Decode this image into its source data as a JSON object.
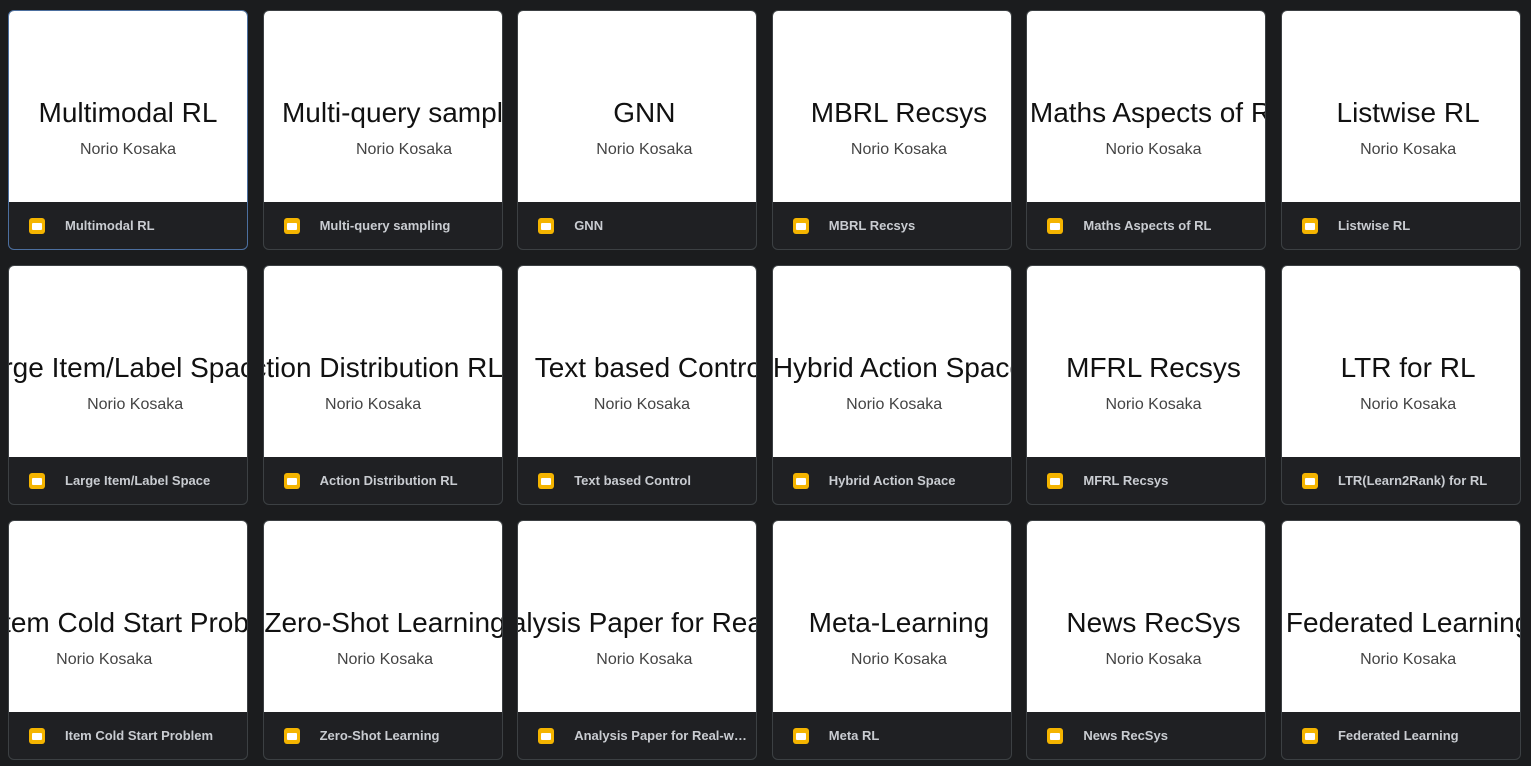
{
  "files": [
    {
      "thumb_title": "Multimodal RL",
      "thumb_author": "Norio Kosaka",
      "name": "Multimodal RL"
    },
    {
      "thumb_title": "Multi-query sampling",
      "thumb_author": "Norio Kosaka",
      "name": "Multi-query sampling"
    },
    {
      "thumb_title": "GNN",
      "thumb_author": "Norio Kosaka",
      "name": "GNN"
    },
    {
      "thumb_title": "MBRL Recsys",
      "thumb_author": "Norio Kosaka",
      "name": "MBRL Recsys"
    },
    {
      "thumb_title": "Maths Aspects of RL",
      "thumb_author": "Norio Kosaka",
      "name": "Maths Aspects of RL"
    },
    {
      "thumb_title": "Listwise RL",
      "thumb_author": "Norio Kosaka",
      "name": "Listwise RL"
    },
    {
      "thumb_title": "Large Item/Label Space",
      "thumb_author": "Norio Kosaka",
      "name": "Large Item/Label Space"
    },
    {
      "thumb_title": "Action Distribution RL",
      "thumb_author": "Norio Kosaka",
      "name": "Action Distribution RL"
    },
    {
      "thumb_title": "Text based Control",
      "thumb_author": "Norio Kosaka",
      "name": "Text based Control"
    },
    {
      "thumb_title": "Hybrid Action Space",
      "thumb_author": "Norio Kosaka",
      "name": "Hybrid Action Space"
    },
    {
      "thumb_title": "MFRL Recsys",
      "thumb_author": "Norio Kosaka",
      "name": "MFRL Recsys"
    },
    {
      "thumb_title": "LTR for RL",
      "thumb_author": "Norio Kosaka",
      "name": "LTR(Learn2Rank) for RL"
    },
    {
      "thumb_title": "Item Cold Start Problem",
      "thumb_author": "Norio Kosaka",
      "name": "Item Cold Start Problem"
    },
    {
      "thumb_title": "Zero-Shot Learning",
      "thumb_author": "Norio Kosaka",
      "name": "Zero-Shot Learning"
    },
    {
      "thumb_title": "Analysis Paper for Real-world",
      "thumb_author": "Norio Kosaka",
      "name": "Analysis Paper for Real-wor…"
    },
    {
      "thumb_title": "Meta-Learning",
      "thumb_author": "Norio Kosaka",
      "name": "Meta RL"
    },
    {
      "thumb_title": "News RecSys",
      "thumb_author": "Norio Kosaka",
      "name": "News RecSys"
    },
    {
      "thumb_title": "Federated Learning",
      "thumb_author": "Norio Kosaka",
      "name": "Federated Learning"
    }
  ],
  "icon": "slides-icon",
  "colors": {
    "background": "#1b1c1e",
    "selected_border": "#4c6f9f",
    "slides_icon": "#f4b400"
  }
}
